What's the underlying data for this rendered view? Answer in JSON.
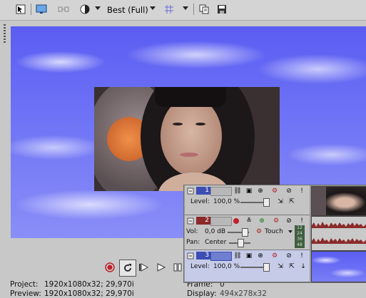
{
  "toolbar": {
    "preview_quality": "Best (Full)"
  },
  "status": {
    "project_label": "Project:",
    "project_value": "1920x1080x32; 29,970i",
    "preview_label": "Preview:",
    "preview_value": "1920x1080x32; 29,970i",
    "frame_label": "Frame:",
    "frame_value": "0",
    "display_label": "Display:",
    "display_value": "494x278x32"
  },
  "tracks": [
    {
      "number": "1",
      "level_label": "Level:",
      "level_value": "100,0 %"
    },
    {
      "number": "2",
      "vol_label": "Vol:",
      "vol_value": "0,0 dB",
      "pan_label": "Pan:",
      "pan_value": "Center",
      "automation": "Touch",
      "meter_labels": [
        "12",
        "24",
        "36",
        "48"
      ]
    },
    {
      "number": "3",
      "level_label": "Level:",
      "level_value": "100,0 %"
    }
  ],
  "colors": {
    "accent_blue": "#3c4db3",
    "record_red": "#c0202a",
    "sky_blue": "#5b5df2"
  }
}
